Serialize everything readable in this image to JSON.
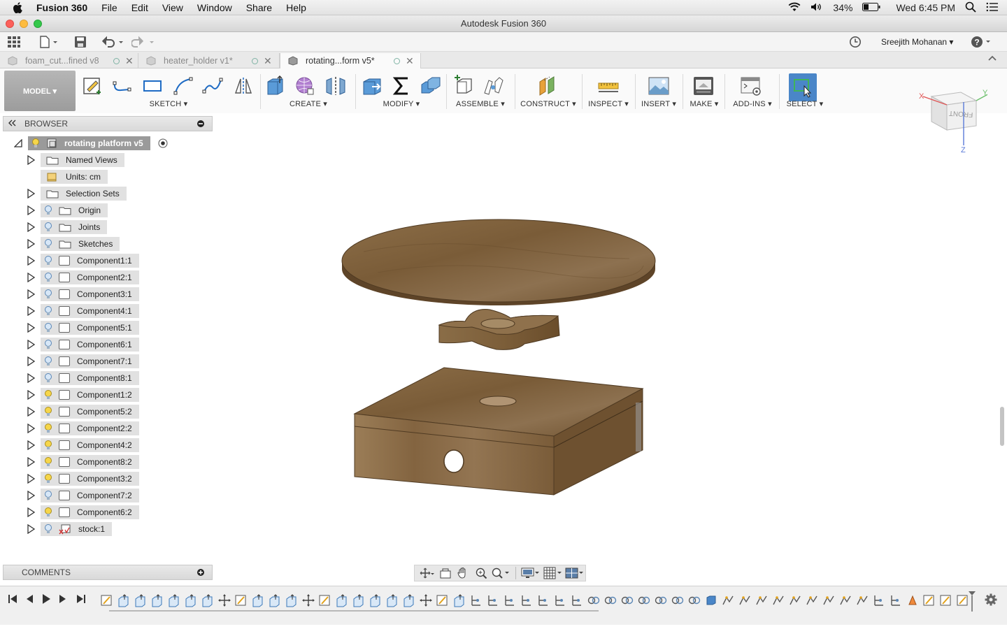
{
  "menubar": {
    "app": "Fusion 360",
    "items": [
      "File",
      "Edit",
      "View",
      "Window",
      "Share",
      "Help"
    ],
    "battery": "34%",
    "clock": "Wed 6:45 PM"
  },
  "window": {
    "title": "Autodesk Fusion 360"
  },
  "quickbar": {
    "user": "Sreejith Mohanan ▾",
    "help": "?"
  },
  "tabs": [
    {
      "label": "foam_cut...fined v8"
    },
    {
      "label": "heater_holder v1*"
    },
    {
      "label": "rotating...form v5*"
    }
  ],
  "toolbar": {
    "workspace": "MODEL ▾",
    "groups": {
      "sketch": "SKETCH ▾",
      "create": "CREATE ▾",
      "modify": "MODIFY ▾",
      "assemble": "ASSEMBLE ▾",
      "construct": "CONSTRUCT ▾",
      "inspect": "INSPECT ▾",
      "insert": "INSERT ▾",
      "make": "MAKE ▾",
      "addins": "ADD-INS ▾",
      "select": "SELECT ▾"
    }
  },
  "browser": {
    "title": "BROWSER",
    "root": "rotating platform v5",
    "nodes": [
      {
        "label": "Named Views",
        "kind": "folder",
        "bulb": "none"
      },
      {
        "label": "Units: cm",
        "kind": "units",
        "bulb": "none"
      },
      {
        "label": "Selection Sets",
        "kind": "folder",
        "bulb": "none"
      },
      {
        "label": "Origin",
        "kind": "folder",
        "bulb": "blue"
      },
      {
        "label": "Joints",
        "kind": "folder",
        "bulb": "blue"
      },
      {
        "label": "Sketches",
        "kind": "folder",
        "bulb": "blue"
      },
      {
        "label": "Component1:1",
        "kind": "comp",
        "bulb": "blue"
      },
      {
        "label": "Component2:1",
        "kind": "comp",
        "bulb": "blue"
      },
      {
        "label": "Component3:1",
        "kind": "comp",
        "bulb": "blue"
      },
      {
        "label": "Component4:1",
        "kind": "comp",
        "bulb": "blue"
      },
      {
        "label": "Component5:1",
        "kind": "comp",
        "bulb": "blue"
      },
      {
        "label": "Component6:1",
        "kind": "comp",
        "bulb": "blue"
      },
      {
        "label": "Component7:1",
        "kind": "comp",
        "bulb": "blue"
      },
      {
        "label": "Component8:1",
        "kind": "comp",
        "bulb": "blue"
      },
      {
        "label": "Component1:2",
        "kind": "comp",
        "bulb": "yellow"
      },
      {
        "label": "Component5:2",
        "kind": "comp",
        "bulb": "yellow"
      },
      {
        "label": "Component2:2",
        "kind": "comp",
        "bulb": "yellow"
      },
      {
        "label": "Component4:2",
        "kind": "comp",
        "bulb": "yellow"
      },
      {
        "label": "Component8:2",
        "kind": "comp",
        "bulb": "yellow"
      },
      {
        "label": "Component3:2",
        "kind": "comp",
        "bulb": "yellow"
      },
      {
        "label": "Component7:2",
        "kind": "comp",
        "bulb": "blue"
      },
      {
        "label": "Component6:2",
        "kind": "comp",
        "bulb": "yellow"
      },
      {
        "label": "stock:1",
        "kind": "stock",
        "bulb": "blue"
      }
    ]
  },
  "comments": {
    "title": "COMMENTS"
  },
  "viewcube": {
    "face": "FRONT",
    "axis_x": "X",
    "axis_y": "Y",
    "axis_z": "Z"
  }
}
